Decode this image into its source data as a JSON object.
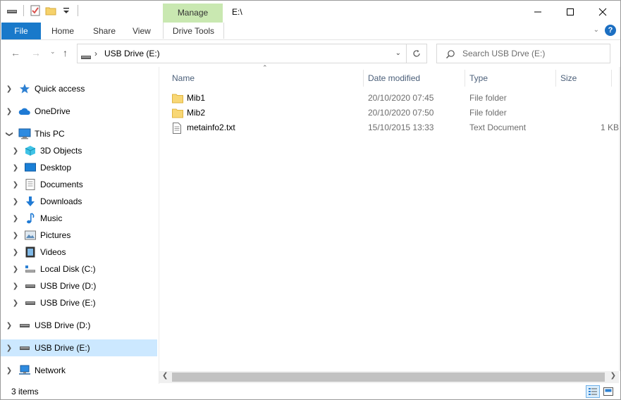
{
  "titlebar": {
    "context_tab": "Manage",
    "path": "E:\\",
    "colors": {
      "context_tab_bg": "#c9e8b1"
    }
  },
  "ribbon": {
    "tabs": [
      {
        "label": "File"
      },
      {
        "label": "Home"
      },
      {
        "label": "Share"
      },
      {
        "label": "View"
      }
    ],
    "context_tab": "Drive Tools",
    "help_label": "?",
    "colors": {
      "file_tab": "#1979ca"
    }
  },
  "address": {
    "path": "USB Drive (E:)"
  },
  "search": {
    "placeholder": "Search USB Drve (E:)"
  },
  "nav": {
    "items": [
      {
        "label": "Quick access",
        "icon": "star-icon"
      },
      {
        "label": "OneDrive",
        "icon": "cloud-icon"
      },
      {
        "label": "This PC",
        "icon": "computer-icon",
        "expanded": true
      },
      {
        "label": "3D Objects",
        "icon": "cube-icon"
      },
      {
        "label": "Desktop",
        "icon": "desktop-icon"
      },
      {
        "label": "Documents",
        "icon": "document-icon"
      },
      {
        "label": "Downloads",
        "icon": "download-icon"
      },
      {
        "label": "Music",
        "icon": "music-icon"
      },
      {
        "label": "Pictures",
        "icon": "pictures-icon"
      },
      {
        "label": "Videos",
        "icon": "video-icon"
      },
      {
        "label": "Local Disk (C:)",
        "icon": "local-disk-icon"
      },
      {
        "label": "USB Drive (D:)",
        "icon": "usb-drive-icon"
      },
      {
        "label": "USB Drive (E:)",
        "icon": "usb-drive-icon"
      },
      {
        "label": "USB Drive (D:)",
        "icon": "usb-drive-icon"
      },
      {
        "label": "USB Drive (E:)",
        "icon": "usb-drive-icon",
        "selected": true
      },
      {
        "label": "Network",
        "icon": "network-icon"
      }
    ],
    "colors": {
      "selected_bg": "#cce8ff"
    }
  },
  "columns": {
    "name": "Name",
    "date": "Date modified",
    "type": "Type",
    "size": "Size"
  },
  "files": [
    {
      "name": "Mib1",
      "date": "20/10/2020 07:45",
      "type": "File folder",
      "size": "",
      "icon": "folder-icon"
    },
    {
      "name": "Mib2",
      "date": "20/10/2020 07:50",
      "type": "File folder",
      "size": "",
      "icon": "folder-icon"
    },
    {
      "name": "metainfo2.txt",
      "date": "15/10/2015 13:33",
      "type": "Text Document",
      "size": "1 KB",
      "icon": "text-file-icon"
    }
  ],
  "status": {
    "item_count": "3 items"
  }
}
